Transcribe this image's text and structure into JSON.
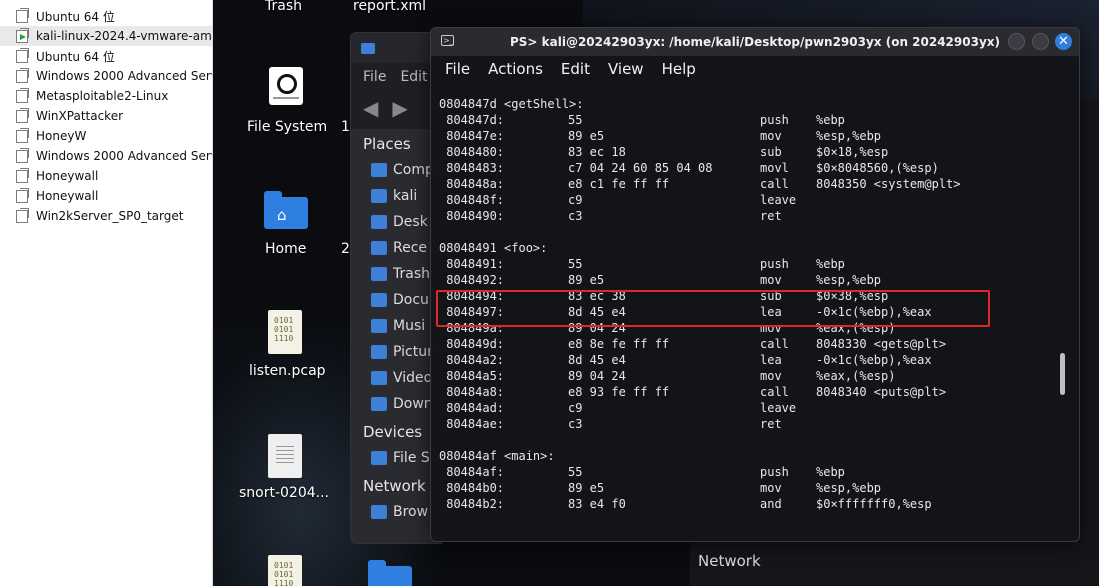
{
  "vm_library": {
    "items": [
      {
        "label": "Ubuntu 64 位",
        "running": false
      },
      {
        "label": "kali-linux-2024.4-vmware-amd",
        "running": true
      },
      {
        "label": "Ubuntu 64 位",
        "running": false
      },
      {
        "label": "Windows 2000 Advanced Serv",
        "running": false
      },
      {
        "label": "Metasploitable2-Linux",
        "running": false
      },
      {
        "label": "WinXPattacker",
        "running": false
      },
      {
        "label": "HoneyW",
        "running": false
      },
      {
        "label": "Windows 2000 Advanced Serv",
        "running": false
      },
      {
        "label": "Honeywall",
        "running": false
      },
      {
        "label": "Honeywall",
        "running": false
      },
      {
        "label": "Win2kServer_SP0_target",
        "running": false
      }
    ]
  },
  "desktop": {
    "icons": {
      "trash": "Trash",
      "report": "report.xml",
      "filesystem": "File System",
      "filesystem_partial": "1",
      "home": "Home",
      "home_partial": "2",
      "listen": "listen.pcap",
      "snort": "snort-0204...",
      "binary_glyph": "0101\n0101\n1110"
    }
  },
  "file_manager": {
    "menu": [
      "File",
      "Edit"
    ],
    "places_header": "Places",
    "places": [
      "Comp",
      "kali",
      "Desk",
      "Rece",
      "Trash",
      "Docu",
      "Musi",
      "Pictur",
      "Video",
      "Down"
    ],
    "devices_header": "Devices",
    "devices": [
      "File S"
    ],
    "network_header": "Network",
    "network": [
      "Brow"
    ]
  },
  "background_window": {
    "network_label": "Network"
  },
  "terminal": {
    "title": "PS> kali@20242903yx: /home/kali/Desktop/pwn2903yx (on 20242903yx)",
    "menu": [
      "File",
      "Actions",
      "Edit",
      "View",
      "Help"
    ],
    "lines": [
      {
        "addr": "0804847d <getShell>:",
        "bytes": "",
        "mn": "",
        "op": "",
        "label": true
      },
      {
        "addr": " 804847d:",
        "bytes": "55",
        "mn": "push",
        "op": "%ebp"
      },
      {
        "addr": " 804847e:",
        "bytes": "89 e5",
        "mn": "mov",
        "op": "%esp,%ebp"
      },
      {
        "addr": " 8048480:",
        "bytes": "83 ec 18",
        "mn": "sub",
        "op": "$0×18,%esp"
      },
      {
        "addr": " 8048483:",
        "bytes": "c7 04 24 60 85 04 08",
        "mn": "movl",
        "op": "$0×8048560,(%esp)"
      },
      {
        "addr": " 804848a:",
        "bytes": "e8 c1 fe ff ff",
        "mn": "call",
        "op": "8048350 <system@plt>"
      },
      {
        "addr": " 804848f:",
        "bytes": "c9",
        "mn": "leave",
        "op": ""
      },
      {
        "addr": " 8048490:",
        "bytes": "c3",
        "mn": "ret",
        "op": ""
      },
      {
        "addr": "",
        "bytes": "",
        "mn": "",
        "op": ""
      },
      {
        "addr": "08048491 <foo>:",
        "bytes": "",
        "mn": "",
        "op": "",
        "label": true
      },
      {
        "addr": " 8048491:",
        "bytes": "55",
        "mn": "push",
        "op": "%ebp"
      },
      {
        "addr": " 8048492:",
        "bytes": "89 e5",
        "mn": "mov",
        "op": "%esp,%ebp"
      },
      {
        "addr": " 8048494:",
        "bytes": "83 ec 38",
        "mn": "sub",
        "op": "$0×38,%esp"
      },
      {
        "addr": " 8048497:",
        "bytes": "8d 45 e4",
        "mn": "lea",
        "op": "-0×1c(%ebp),%eax"
      },
      {
        "addr": " 804849a:",
        "bytes": "89 04 24",
        "mn": "mov",
        "op": "%eax,(%esp)"
      },
      {
        "addr": " 804849d:",
        "bytes": "e8 8e fe ff ff",
        "mn": "call",
        "op": "8048330 <gets@plt>"
      },
      {
        "addr": " 80484a2:",
        "bytes": "8d 45 e4",
        "mn": "lea",
        "op": "-0×1c(%ebp),%eax"
      },
      {
        "addr": " 80484a5:",
        "bytes": "89 04 24",
        "mn": "mov",
        "op": "%eax,(%esp)"
      },
      {
        "addr": " 80484a8:",
        "bytes": "e8 93 fe ff ff",
        "mn": "call",
        "op": "8048340 <puts@plt>"
      },
      {
        "addr": " 80484ad:",
        "bytes": "c9",
        "mn": "leave",
        "op": ""
      },
      {
        "addr": " 80484ae:",
        "bytes": "c3",
        "mn": "ret",
        "op": ""
      },
      {
        "addr": "",
        "bytes": "",
        "mn": "",
        "op": ""
      },
      {
        "addr": "080484af <main>:",
        "bytes": "",
        "mn": "",
        "op": "",
        "label": true
      },
      {
        "addr": " 80484af:",
        "bytes": "55",
        "mn": "push",
        "op": "%ebp"
      },
      {
        "addr": " 80484b0:",
        "bytes": "89 e5",
        "mn": "mov",
        "op": "%esp,%ebp"
      },
      {
        "addr": " 80484b2:",
        "bytes": "83 e4 f0",
        "mn": "and",
        "op": "$0×fffffff0,%esp"
      }
    ]
  },
  "colors": {
    "highlight_box": "#e02828",
    "accent": "#2f7fe0",
    "terminal_bg": "#14151a"
  }
}
